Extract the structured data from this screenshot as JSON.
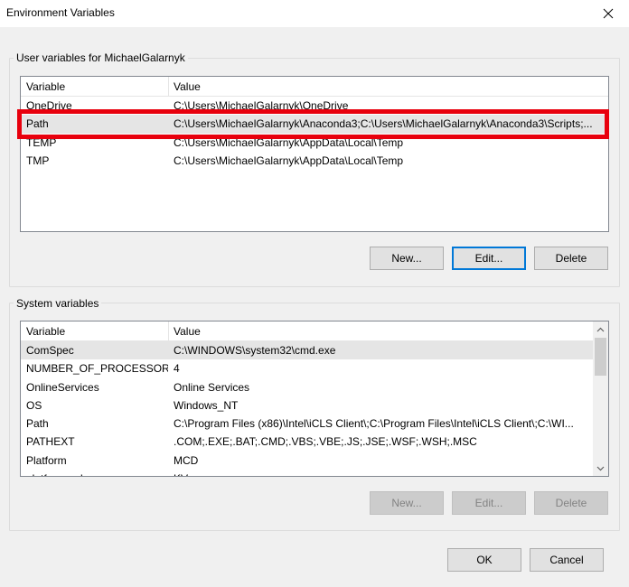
{
  "window": {
    "title": "Environment Variables"
  },
  "user_vars": {
    "label": "User variables for MichaelGalarnyk",
    "header": {
      "variable": "Variable",
      "value": "Value"
    },
    "rows": [
      {
        "name": "OneDrive",
        "value": "C:\\Users\\MichaelGalarnyk\\OneDrive"
      },
      {
        "name": "Path",
        "value": "C:\\Users\\MichaelGalarnyk\\Anaconda3;C:\\Users\\MichaelGalarnyk\\Anaconda3\\Scripts;..."
      },
      {
        "name": "TEMP",
        "value": "C:\\Users\\MichaelGalarnyk\\AppData\\Local\\Temp"
      },
      {
        "name": "TMP",
        "value": "C:\\Users\\MichaelGalarnyk\\AppData\\Local\\Temp"
      }
    ],
    "buttons": {
      "new": "New...",
      "edit": "Edit...",
      "delete": "Delete"
    }
  },
  "system_vars": {
    "label": "System variables",
    "header": {
      "variable": "Variable",
      "value": "Value"
    },
    "rows": [
      {
        "name": "ComSpec",
        "value": "C:\\WINDOWS\\system32\\cmd.exe"
      },
      {
        "name": "NUMBER_OF_PROCESSORS",
        "value": "4"
      },
      {
        "name": "OnlineServices",
        "value": "Online Services"
      },
      {
        "name": "OS",
        "value": "Windows_NT"
      },
      {
        "name": "Path",
        "value": "C:\\Program Files (x86)\\Intel\\iCLS Client\\;C:\\Program Files\\Intel\\iCLS Client\\;C:\\WI..."
      },
      {
        "name": "PATHEXT",
        "value": ".COM;.EXE;.BAT;.CMD;.VBS;.VBE;.JS;.JSE;.WSF;.WSH;.MSC"
      },
      {
        "name": "Platform",
        "value": "MCD"
      },
      {
        "name": "platformcode",
        "value": "KV"
      }
    ],
    "buttons": {
      "new": "New...",
      "edit": "Edit...",
      "delete": "Delete"
    }
  },
  "footer": {
    "ok": "OK",
    "cancel": "Cancel"
  },
  "colors": {
    "highlight": "#e8000d",
    "selected_row": "#e5e5e5",
    "default_button_border": "#0078d7"
  }
}
